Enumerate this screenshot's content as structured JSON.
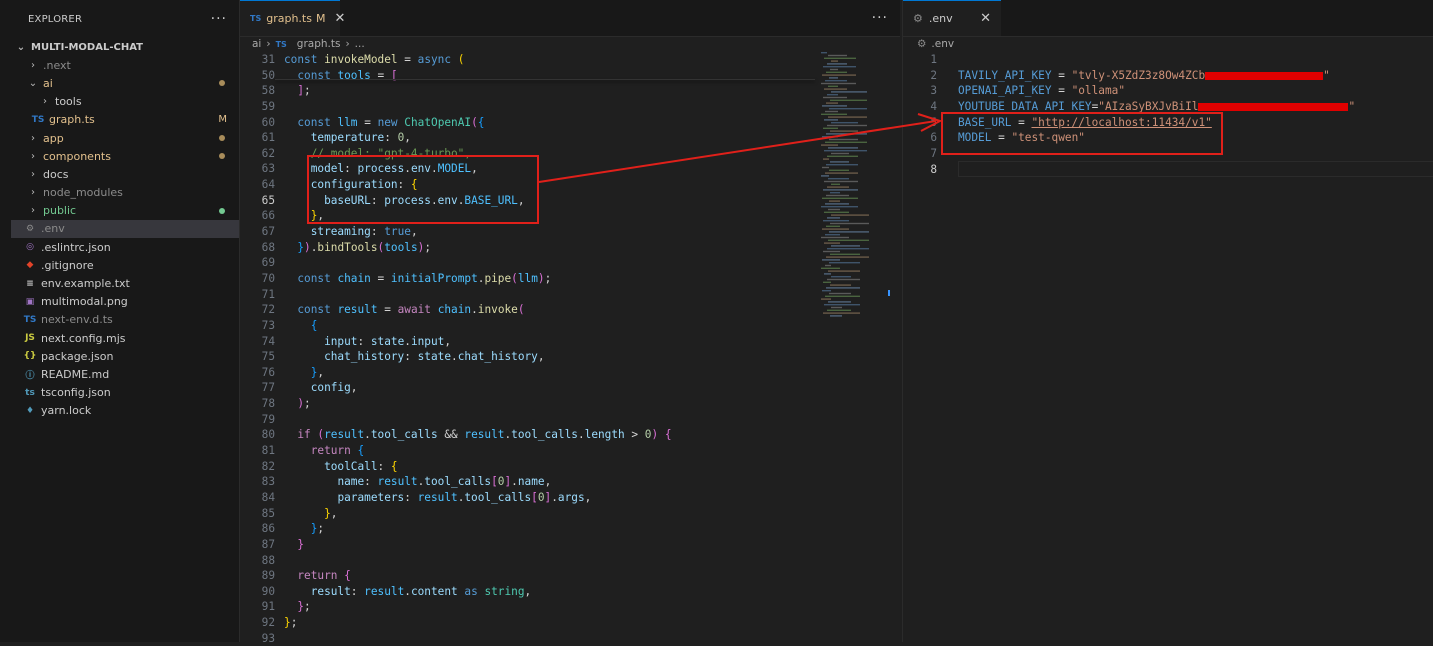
{
  "explorer": {
    "title": "EXPLORER",
    "more": "···",
    "project": "MULTI-MODAL-CHAT",
    "items": [
      {
        "label": ".next",
        "kind": "folder",
        "color": "gray"
      },
      {
        "label": "ai",
        "kind": "folder-open",
        "color": "yellow"
      },
      {
        "label": "tools",
        "kind": "folder",
        "color": "normal"
      },
      {
        "label": "graph.ts",
        "kind": "ts",
        "color": "yellow",
        "status": "M"
      },
      {
        "label": "app",
        "kind": "folder",
        "color": "yellow"
      },
      {
        "label": "components",
        "kind": "folder",
        "color": "yellow"
      },
      {
        "label": "docs",
        "kind": "folder",
        "color": "normal"
      },
      {
        "label": "node_modules",
        "kind": "folder",
        "color": "gray"
      },
      {
        "label": "public",
        "kind": "folder",
        "color": "green"
      },
      {
        "label": ".env",
        "kind": "gear",
        "color": "gray"
      },
      {
        "label": ".eslintrc.json",
        "kind": "eslint",
        "color": "normal"
      },
      {
        "label": ".gitignore",
        "kind": "git",
        "color": "normal"
      },
      {
        "label": "env.example.txt",
        "kind": "txt",
        "color": "normal"
      },
      {
        "label": "multimodal.png",
        "kind": "img",
        "color": "normal"
      },
      {
        "label": "next-env.d.ts",
        "kind": "ts",
        "color": "gray"
      },
      {
        "label": "next.config.mjs",
        "kind": "js",
        "color": "normal"
      },
      {
        "label": "package.json",
        "kind": "json",
        "color": "normal"
      },
      {
        "label": "README.md",
        "kind": "info",
        "color": "normal"
      },
      {
        "label": "tsconfig.json",
        "kind": "tsconfig",
        "color": "normal"
      },
      {
        "label": "yarn.lock",
        "kind": "yarn",
        "color": "normal"
      }
    ]
  },
  "left_editor": {
    "tab_label": "graph.ts",
    "tab_status": "M",
    "tab_badge": "TS",
    "more": "···",
    "breadcrumb": [
      "ai",
      "graph.ts",
      "..."
    ],
    "line_numbers": [
      "31",
      "50",
      "58",
      "59",
      "60",
      "61",
      "62",
      "63",
      "64",
      "65",
      "66",
      "67",
      "68",
      "69",
      "70",
      "71",
      "72",
      "73",
      "74",
      "75",
      "76",
      "77",
      "78",
      "79",
      "80",
      "81",
      "82",
      "83",
      "84",
      "85",
      "86",
      "87",
      "88",
      "89",
      "90",
      "91",
      "92",
      "93"
    ]
  },
  "right_editor": {
    "tab_label": ".env",
    "breadcrumb": ".env",
    "lines": [
      {
        "num": "1"
      },
      {
        "num": "2",
        "key": "TAVILY_API_KEY",
        "sep": " = ",
        "value": "\"tvly-X5ZdZ3z8Ow4ZCb"
      },
      {
        "num": "3",
        "key": "OPENAI_API_KEY",
        "sep": " = ",
        "value": "\"ollama\""
      },
      {
        "num": "4",
        "key": "YOUTUBE_DATA_API_KEY",
        "sep": "=",
        "value": "\"AIzaSyBXJvBiIl"
      },
      {
        "num": "5",
        "key": "BASE_URL",
        "sep": " = ",
        "value": "\"http://localhost:11434/v1\""
      },
      {
        "num": "6",
        "key": "MODEL",
        "sep": " = ",
        "value": "\"test-qwen\""
      },
      {
        "num": "7"
      },
      {
        "num": "8"
      }
    ]
  },
  "colors": {
    "annotation_red": "#e0201a",
    "editor_bg": "#1f1f1f",
    "sidebar_bg": "#181818"
  }
}
